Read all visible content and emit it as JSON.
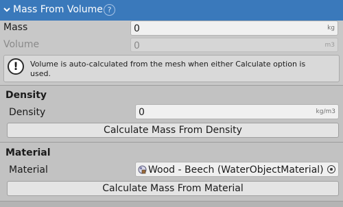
{
  "header": {
    "title": "Mass From Volume",
    "help_glyph": "?",
    "collapse_icon": "chevron-down-icon",
    "help_icon": "help-circle-icon"
  },
  "mass": {
    "label": "Mass",
    "value": "0",
    "unit": "kg"
  },
  "volume": {
    "label": "Volume",
    "value": "0",
    "unit": "m3"
  },
  "notice": {
    "icon": "warning-icon",
    "glyph": "!",
    "text": "Volume is auto-calculated from the mesh when either Calculate option is used."
  },
  "density_section": {
    "title": "Density",
    "label": "Density",
    "value": "0",
    "unit": "kg/m3",
    "button": "Calculate Mass From Density"
  },
  "material_section": {
    "title": "Material",
    "label": "Material",
    "value": "Wood - Beech (WaterObjectMaterial)",
    "object_icon": "material-icon",
    "picker_icon": "object-picker-icon",
    "button": "Calculate Mass From Material"
  },
  "colors": {
    "header_bg": "#3a79bb",
    "panel_bg": "#c8c8c8",
    "section_bg": "#c2c2c2",
    "field_bg": "#f0f0f0"
  }
}
